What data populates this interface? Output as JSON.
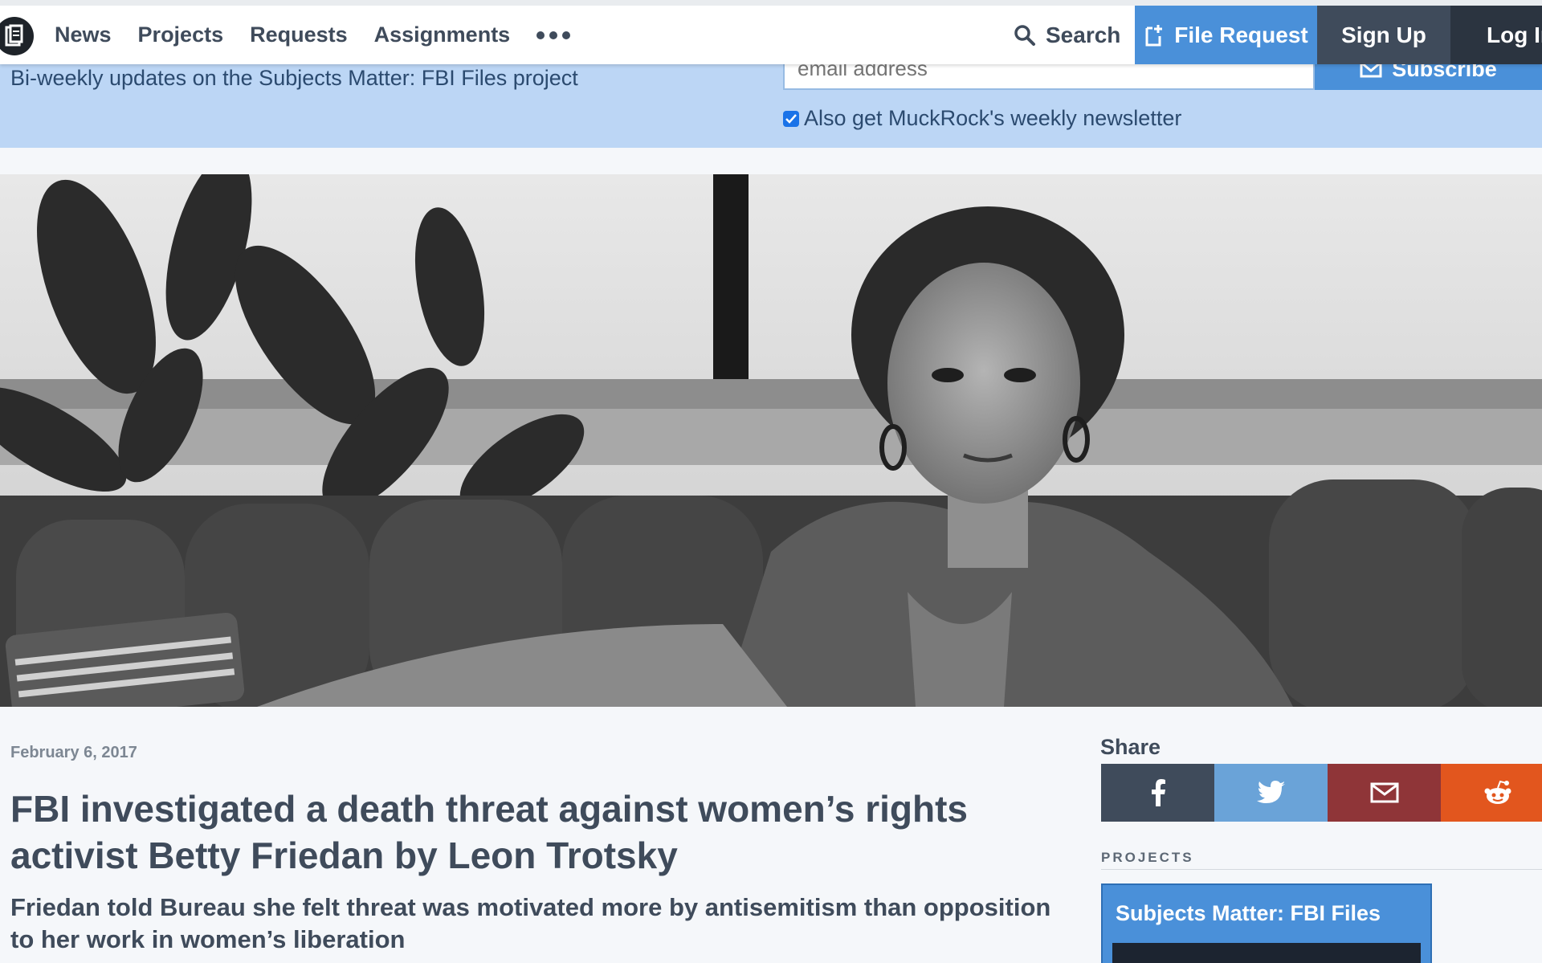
{
  "nav": {
    "links": [
      "News",
      "Projects",
      "Requests",
      "Assignments"
    ],
    "more_icon": "ellipsis-icon",
    "search_label": "Search",
    "file_request_label": "File Request",
    "sign_up_label": "Sign Up",
    "log_in_label": "Log In"
  },
  "newsletter": {
    "description": "Bi-weekly updates on the Subjects Matter: FBI Files project",
    "email_placeholder": "email address",
    "subscribe_label": "Subscribe",
    "also_get_label": "Also get MuckRock's weekly newsletter",
    "also_get_checked": true
  },
  "article": {
    "date": "February 6, 2017",
    "title": "FBI investigated a death threat against women’s rights activist Betty Friedan by Leon Trotsky",
    "subtitle": "Friedan told Bureau she felt threat was motivated more by antisemitism than opposition to her work in women’s liberation"
  },
  "sidebar": {
    "share_label": "Share",
    "share_buttons": [
      {
        "name": "facebook-icon",
        "color": "#3f4b5b"
      },
      {
        "name": "twitter-icon",
        "color": "#6aa3d8"
      },
      {
        "name": "email-icon",
        "color": "#8f3538"
      },
      {
        "name": "reddit-icon",
        "color": "#e2561e"
      }
    ],
    "projects_label": "PROJECTS",
    "project_card_title": "Subjects Matter: FBI Files"
  },
  "colors": {
    "accent": "#4a90d9",
    "newsletter_band": "#bcd6f5",
    "dark": "#3f4b5b"
  }
}
